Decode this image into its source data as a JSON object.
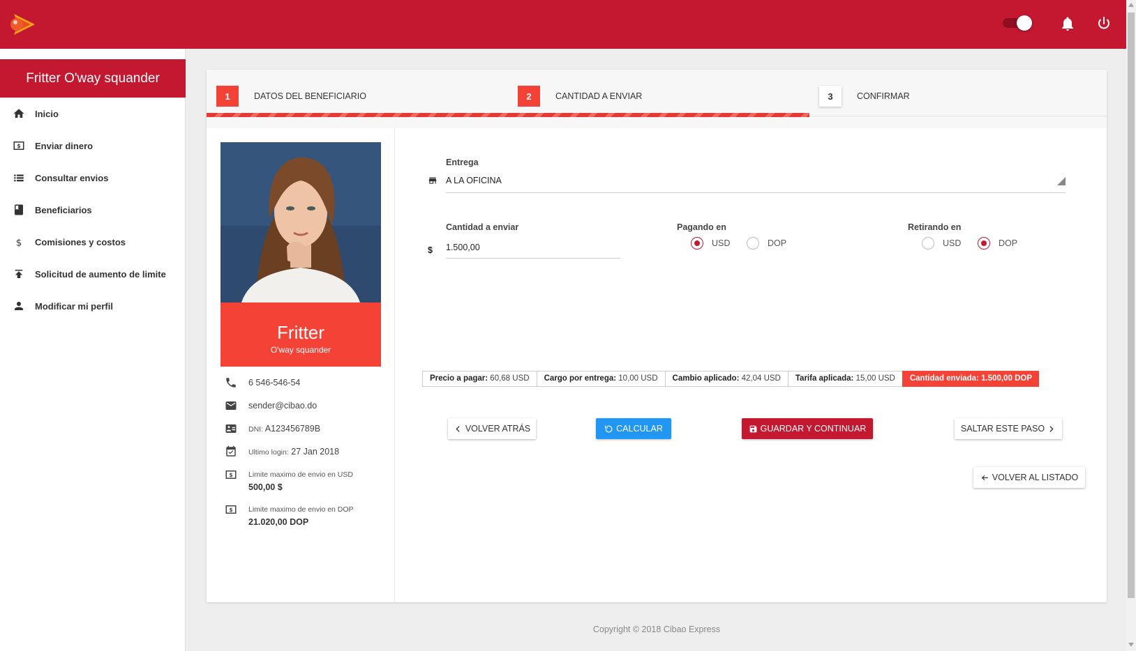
{
  "colors": {
    "brand": "#c41730",
    "accent": "#f44336",
    "blue": "#2196f3"
  },
  "header": {
    "icons": [
      "logo-icon",
      "toggle-switch",
      "bell-icon",
      "power-icon"
    ]
  },
  "sidebar": {
    "title": "Fritter O'way squander",
    "items": [
      {
        "label": "Inicio",
        "icon": "home-icon"
      },
      {
        "label": "Enviar dinero",
        "icon": "money-icon"
      },
      {
        "label": "Consultar envios",
        "icon": "list-icon"
      },
      {
        "label": "Beneficiarios",
        "icon": "book-icon"
      },
      {
        "label": "Comisiones y costos",
        "icon": "dollar-icon"
      },
      {
        "label": "Solicitud de aumento de limite",
        "icon": "upload-icon"
      },
      {
        "label": "Modificar mi perfil",
        "icon": "person-icon"
      }
    ]
  },
  "stepper": {
    "steps": [
      {
        "number": "1",
        "label": "DATOS DEL BENEFICIARIO"
      },
      {
        "number": "2",
        "label": "CANTIDAD A ENVIAR"
      },
      {
        "number": "3",
        "label": "CONFIRMAR"
      }
    ],
    "current_step": 2
  },
  "profile": {
    "first_name": "Fritter",
    "last_name": "O'way squander",
    "phone": "6 546-546-54",
    "email": "sender@cibao.do",
    "dni_label": "DNI:",
    "dni_value": "A123456789B",
    "last_login_label": "Ultimo login:",
    "last_login_value": "27 Jan 2018",
    "limit_usd_label": "Limite maximo de envio en USD",
    "limit_usd_value": "500,00 $",
    "limit_dop_label": "Limite maximo de envio en DOP",
    "limit_dop_value": "21.020,00 DOP"
  },
  "form": {
    "entrega_label": "Entrega",
    "entrega_value": "A LA OFICINA",
    "cantidad_label": "Cantidad a enviar",
    "currency_symbol": "$",
    "cantidad_value": "1.500,00",
    "pagando_label": "Pagando en",
    "pagando_options": [
      "USD",
      "DOP"
    ],
    "pagando_selected": "USD",
    "retirando_label": "Retirando en",
    "retirando_options": [
      "USD",
      "DOP"
    ],
    "retirando_selected": "DOP"
  },
  "summary": [
    {
      "label": "Precio a pagar:",
      "value": "60,68 USD"
    },
    {
      "label": "Cargo por entrega:",
      "value": "10,00 USD"
    },
    {
      "label": "Cambio aplicado:",
      "value": "42,04 USD"
    },
    {
      "label": "Tarifa aplicada:",
      "value": "15,00 USD"
    },
    {
      "label": "Cantidad enviada:",
      "value": "1.500,00 DOP"
    }
  ],
  "buttons": {
    "back": "VOLVER ATRÁS",
    "calculate": "CALCULAR",
    "save": "GUARDAR Y CONTINUAR",
    "skip": "SALTAR ESTE PASO",
    "back_to_list": "VOLVER AL LISTADO"
  },
  "footer": {
    "copyright": "Copyright © 2018 Cibao Express"
  }
}
